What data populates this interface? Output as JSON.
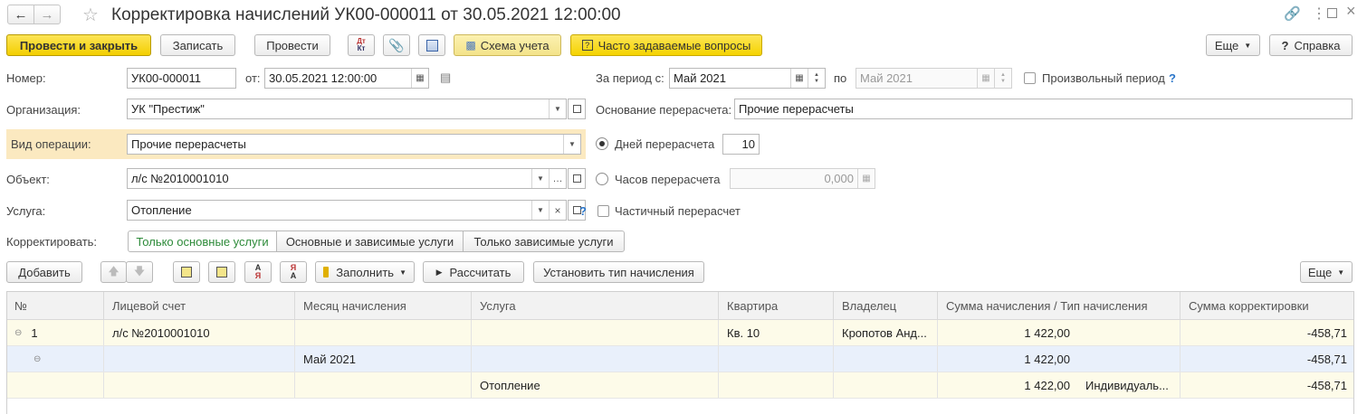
{
  "window": {
    "title": "Корректировка начислений УК00-000011 от 30.05.2021 12:00:00"
  },
  "toolbar": {
    "post_close": "Провести и закрыть",
    "save": "Записать",
    "post": "Провести",
    "dt_kt": "Дт Кт",
    "scheme": "Схема учета",
    "faq": "Часто задаваемые вопросы",
    "more": "Еще",
    "help": "Справка"
  },
  "form": {
    "number_label": "Номер:",
    "number_value": "УК00-000011",
    "from_label": "от:",
    "date_value": "30.05.2021 12:00:00",
    "period_from_label": "За период с:",
    "period_from_value": "Май 2021",
    "period_to_label": "по",
    "period_to_value": "Май 2021",
    "arbitrary_period_label": "Произвольный период",
    "org_label": "Организация:",
    "org_value": "УК \"Престиж\"",
    "basis_label": "Основание перерасчета:",
    "basis_value": "Прочие перерасчеты",
    "op_type_label": "Вид операции:",
    "op_type_value": "Прочие перерасчеты",
    "days_label": "Дней перерасчета",
    "days_value": "10",
    "object_label": "Объект:",
    "object_value": "л/с №2010001010",
    "hours_label": "Часов перерасчета",
    "hours_value": "0,000",
    "service_label": "Услуга:",
    "service_value": "Отопление",
    "partial_label": "Частичный перерасчет",
    "correct_label": "Корректировать:",
    "seg_main": "Только основные услуги",
    "seg_main_dep": "Основные и зависимые услуги",
    "seg_dep": "Только зависимые услуги",
    "help_mark": "?"
  },
  "table_toolbar": {
    "add": "Добавить",
    "fill": "Заполнить",
    "calc": "Рассчитать",
    "set_type": "Установить тип начисления",
    "more": "Еще"
  },
  "table": {
    "columns": [
      "№",
      "Лицевой счет",
      "Месяц начисления",
      "Услуга",
      "Квартира",
      "Владелец",
      "Сумма начисления / Тип начисления",
      "Сумма корректировки"
    ],
    "rows": [
      {
        "num": "1",
        "account": "л/с №2010001010",
        "month": "",
        "service": "",
        "flat": "Кв. 10",
        "owner": "Кропотов Анд...",
        "sum": "1 422,00",
        "type": "",
        "corr": "-458,71"
      },
      {
        "num": "",
        "account": "",
        "month": "Май 2021",
        "service": "",
        "flat": "",
        "owner": "",
        "sum": "1 422,00",
        "type": "",
        "corr": "-458,71"
      },
      {
        "num": "",
        "account": "",
        "month": "",
        "service": "Отопление",
        "flat": "",
        "owner": "",
        "sum": "1 422,00",
        "type": "Индивидуаль...",
        "corr": "-458,71"
      }
    ]
  },
  "colors": {
    "accent_yellow": "#f5d300",
    "highlight_label": "#fbe9c0",
    "row_group": "#fdfbe9",
    "row_sub": "#e9f0fb",
    "active_seg_text": "#2e8b3a",
    "help_blue": "#2b76c9"
  }
}
